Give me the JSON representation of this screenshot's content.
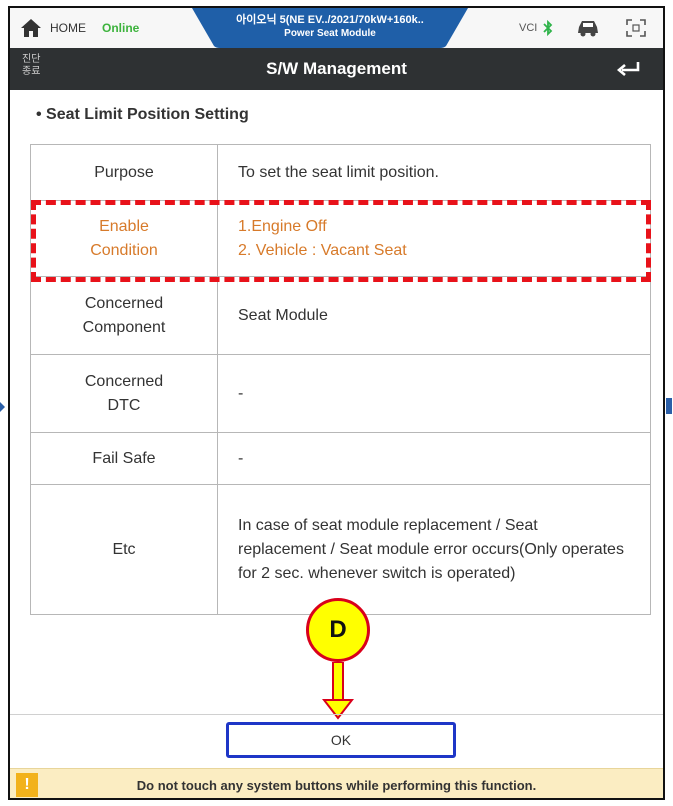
{
  "statusbar": {
    "home_label": "HOME",
    "online_label": "Online",
    "vehicle_line1": "아이오닉 5(NE EV../2021/70kW+160k..",
    "vehicle_line2": "Power Seat Module",
    "vci_label": "VCI"
  },
  "titlebar": {
    "side_label": "진단 종료",
    "title": "S/W Management"
  },
  "section_title": "• Seat Limit Position Setting",
  "table": {
    "rows": [
      {
        "key": "Purpose",
        "value": "To set the seat limit position."
      },
      {
        "key": "Enable Condition",
        "value_lines": [
          "1.Engine Off",
          "2. Vehicle : Vacant Seat"
        ]
      },
      {
        "key": "Concerned Component",
        "value": "Seat Module"
      },
      {
        "key": "Concerned DTC",
        "value": "-"
      },
      {
        "key": "Fail Safe",
        "value": "-"
      },
      {
        "key": "Etc",
        "value": "In case of seat module replacement / Seat replacement / Seat module error occurs(Only operates for 2 sec. whenever switch is operated)"
      }
    ]
  },
  "marker_label": "D",
  "ok_label": "OK",
  "warning": {
    "icon": "!",
    "text": "Do not touch any system buttons while performing this function."
  },
  "colors": {
    "highlight_text": "#d77a2a",
    "dash_border": "#e8121a",
    "ok_border": "#1e36c7",
    "tab_blue": "#1f5fa8"
  },
  "icons": [
    "home-icon",
    "bluetooth-icon",
    "car-icon",
    "expand-icon",
    "back-arrow-icon",
    "warning-icon"
  ]
}
